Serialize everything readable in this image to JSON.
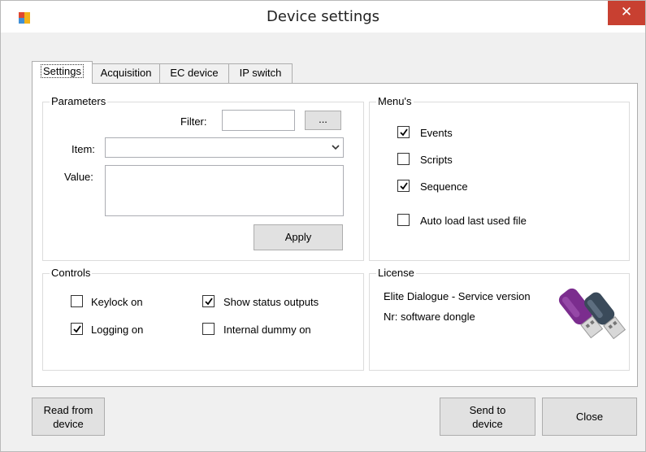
{
  "window": {
    "title": "Device settings",
    "close_glyph": "✕"
  },
  "tabs": [
    {
      "label": "Settings",
      "active": true
    },
    {
      "label": "Acquisition",
      "active": false
    },
    {
      "label": "EC device",
      "active": false
    },
    {
      "label": "IP switch",
      "active": false
    }
  ],
  "parameters": {
    "group_title": "Parameters",
    "filter_label": "Filter:",
    "filter_value": "",
    "browse_label": "...",
    "item_label": "Item:",
    "item_value": "",
    "value_label": "Value:",
    "value_text": "",
    "apply_label": "Apply"
  },
  "menus": {
    "group_title": "Menu's",
    "items": [
      {
        "label": "Events",
        "checked": true
      },
      {
        "label": "Scripts",
        "checked": false
      },
      {
        "label": "Sequence",
        "checked": true
      },
      {
        "label": "Auto load last used file",
        "checked": false
      }
    ]
  },
  "controls": {
    "group_title": "Controls",
    "items": [
      {
        "label": "Keylock on",
        "checked": false
      },
      {
        "label": "Show status outputs",
        "checked": true
      },
      {
        "label": "Logging on",
        "checked": true
      },
      {
        "label": "Internal dummy on",
        "checked": false
      }
    ]
  },
  "license": {
    "group_title": "License",
    "line1": "Elite Dialogue - Service version",
    "line2": "Nr: software dongle"
  },
  "buttons": {
    "read_from_device": [
      "Read from",
      "device"
    ],
    "send_to_device": [
      "Send to",
      "device"
    ],
    "close": "Close"
  },
  "colors": {
    "close_button_bg": "#c84031",
    "dongle_purple": "#7b2d8e",
    "dongle_dark": "#3a4a5a"
  }
}
